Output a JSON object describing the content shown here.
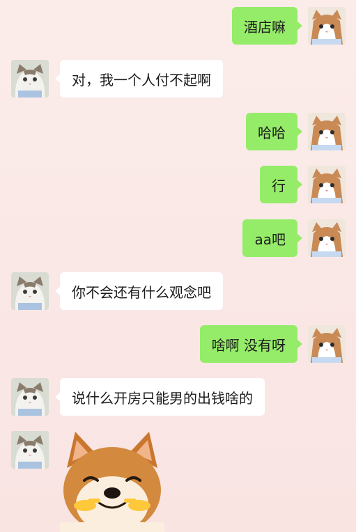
{
  "chat": {
    "messages": [
      {
        "side": "right",
        "text": "酒店嘛"
      },
      {
        "side": "left",
        "text": "对，我一个人付不起啊"
      },
      {
        "side": "right",
        "text": "哈哈"
      },
      {
        "side": "right",
        "text": "行"
      },
      {
        "side": "right",
        "text": "aa吧"
      },
      {
        "side": "left",
        "text": "你不会还有什么观念吧"
      },
      {
        "side": "right",
        "text": "啥啊 没有呀"
      },
      {
        "side": "left",
        "text": "说什么开房只能男的出钱啥的"
      }
    ],
    "sticker": {
      "type": "shiba-dog-pointing-fingers"
    }
  },
  "colors": {
    "my_bubble": "#95ec69",
    "other_bubble": "#ffffff",
    "background": "#fbecea"
  }
}
